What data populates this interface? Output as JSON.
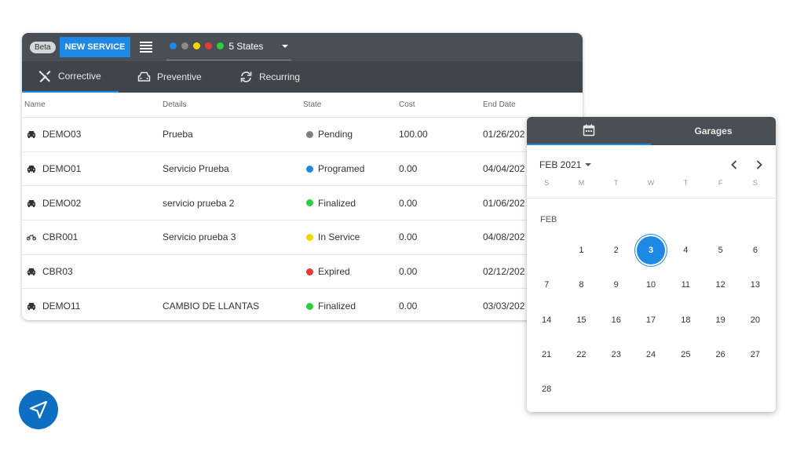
{
  "toolbar": {
    "beta_label": "Beta",
    "new_service_label": "NEW SERVICE",
    "states_label": "5 States",
    "state_dot_colors": [
      "#1e88e5",
      "#8a8a8a",
      "#f2d600",
      "#e53935",
      "#2ecc40"
    ]
  },
  "tabs": [
    {
      "label": "Corrective",
      "icon": "wrench-screwdriver-icon",
      "active": true
    },
    {
      "label": "Preventive",
      "icon": "car-icon",
      "active": false
    },
    {
      "label": "Recurring",
      "icon": "sync-icon",
      "active": false
    }
  ],
  "table": {
    "headers": [
      "Name",
      "Details",
      "State",
      "Cost",
      "End Date"
    ],
    "rows": [
      {
        "vehicle_icon": "car-icon",
        "name": "DEMO03",
        "details": "Prueba",
        "state": "Pending",
        "state_color": "#808080",
        "cost": "100.00",
        "end_date": "01/26/202"
      },
      {
        "vehicle_icon": "car-icon",
        "name": "DEMO01",
        "details": "Servicio Prueba",
        "state": "Programed",
        "state_color": "#1e88e5",
        "cost": "0.00",
        "end_date": "04/04/202"
      },
      {
        "vehicle_icon": "car-icon",
        "name": "DEMO02",
        "details": "servicio prueba 2",
        "state": "Finalized",
        "state_color": "#2ecc40",
        "cost": "0.00",
        "end_date": "01/06/202"
      },
      {
        "vehicle_icon": "motorcycle-icon",
        "name": "CBR001",
        "details": "Servicio prueba 3",
        "state": "In Service",
        "state_color": "#f2d600",
        "cost": "0.00",
        "end_date": "04/08/202"
      },
      {
        "vehicle_icon": "car-icon",
        "name": "CBR03",
        "details": "",
        "state": "Expired",
        "state_color": "#e53935",
        "cost": "0.00",
        "end_date": "02/12/202"
      },
      {
        "vehicle_icon": "car-icon",
        "name": "DEMO11",
        "details": "CAMBIO DE LLANTAS",
        "state": "Finalized",
        "state_color": "#2ecc40",
        "cost": "0.00",
        "end_date": "03/03/202"
      }
    ]
  },
  "calendar": {
    "tab_icon": "calendar-icon",
    "garages_label": "Garages",
    "month_label": "FEB 2021",
    "weekdays": [
      "S",
      "M",
      "T",
      "W",
      "T",
      "F",
      "S"
    ],
    "month_name": "FEB",
    "first_weekday_index": 1,
    "days": [
      "1",
      "2",
      "3",
      "4",
      "5",
      "6",
      "7",
      "8",
      "9",
      "10",
      "11",
      "12",
      "13",
      "14",
      "15",
      "16",
      "17",
      "18",
      "19",
      "20",
      "21",
      "22",
      "23",
      "24",
      "25",
      "26",
      "27",
      "28"
    ],
    "selected_day": "3",
    "accent_color": "#1e88e5"
  },
  "fab_icon": "navigation-arrow-icon"
}
